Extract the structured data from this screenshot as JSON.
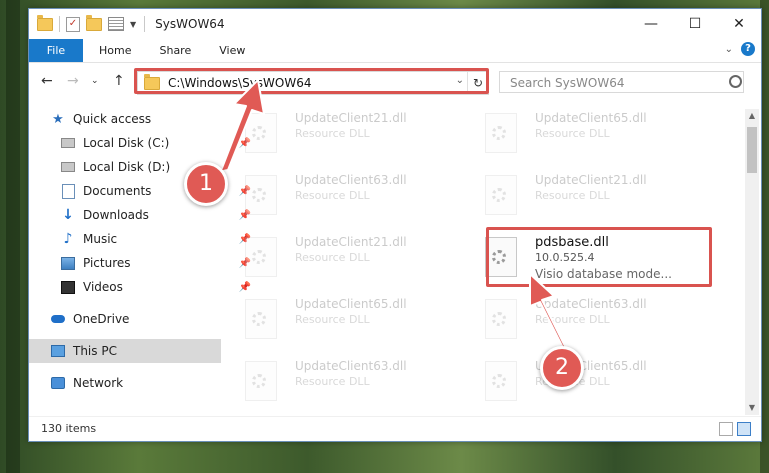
{
  "window": {
    "title": "SysWOW64",
    "controls": {
      "minimize": "—",
      "maximize": "☐",
      "close": "✕"
    }
  },
  "ribbon": {
    "tabs": [
      "File",
      "Home",
      "Share",
      "View"
    ],
    "help": "?"
  },
  "navigation": {
    "address": "C:\\Windows\\SysWOW64",
    "search_placeholder": "Search SysWOW64"
  },
  "sidebar": {
    "items": [
      {
        "label": "Quick access",
        "icon": "star-icon"
      },
      {
        "label": "Local Disk (C:)",
        "icon": "disk-icon",
        "pinned": true
      },
      {
        "label": "Local Disk (D:)",
        "icon": "disk-icon"
      },
      {
        "label": "Documents",
        "icon": "documents-icon",
        "pinned": true
      },
      {
        "label": "Downloads",
        "icon": "downloads-icon",
        "pinned": true
      },
      {
        "label": "Music",
        "icon": "music-icon",
        "pinned": true
      },
      {
        "label": "Pictures",
        "icon": "pictures-icon",
        "pinned": true
      },
      {
        "label": "Videos",
        "icon": "videos-icon",
        "pinned": true
      },
      {
        "label": "OneDrive",
        "icon": "onedrive-icon"
      },
      {
        "label": "This PC",
        "icon": "pc-icon",
        "selected": true
      },
      {
        "label": "Network",
        "icon": "network-icon"
      }
    ]
  },
  "files": [
    {
      "name": "UpdateClient21.dll",
      "desc": "Resource DLL"
    },
    {
      "name": "UpdateClient65.dll",
      "desc": "Resource DLL"
    },
    {
      "name": "UpdateClient63.dll",
      "desc": "Resource DLL"
    },
    {
      "name": "UpdateClient21.dll",
      "desc": "Resource DLL"
    },
    {
      "name": "UpdateClient21.dll",
      "desc": "Resource DLL"
    },
    {
      "name": "pdsbase.dll",
      "desc": "10.0.525.4",
      "desc2": "Visio database mode..."
    },
    {
      "name": "UpdateClient65.dll",
      "desc": "Resource DLL"
    },
    {
      "name": "UpdateClient63.dll",
      "desc": "Resource DLL"
    },
    {
      "name": "UpdateClient63.dll",
      "desc": "Resource DLL"
    },
    {
      "name": "UpdateClient65.dll",
      "desc": "Resource DLL"
    }
  ],
  "status": {
    "item_count": "130 items"
  },
  "annotations": {
    "step1": "1",
    "step2": "2"
  },
  "colors": {
    "accent": "#1979ca",
    "highlight": "#d9534f",
    "callout": "#e05a55"
  }
}
